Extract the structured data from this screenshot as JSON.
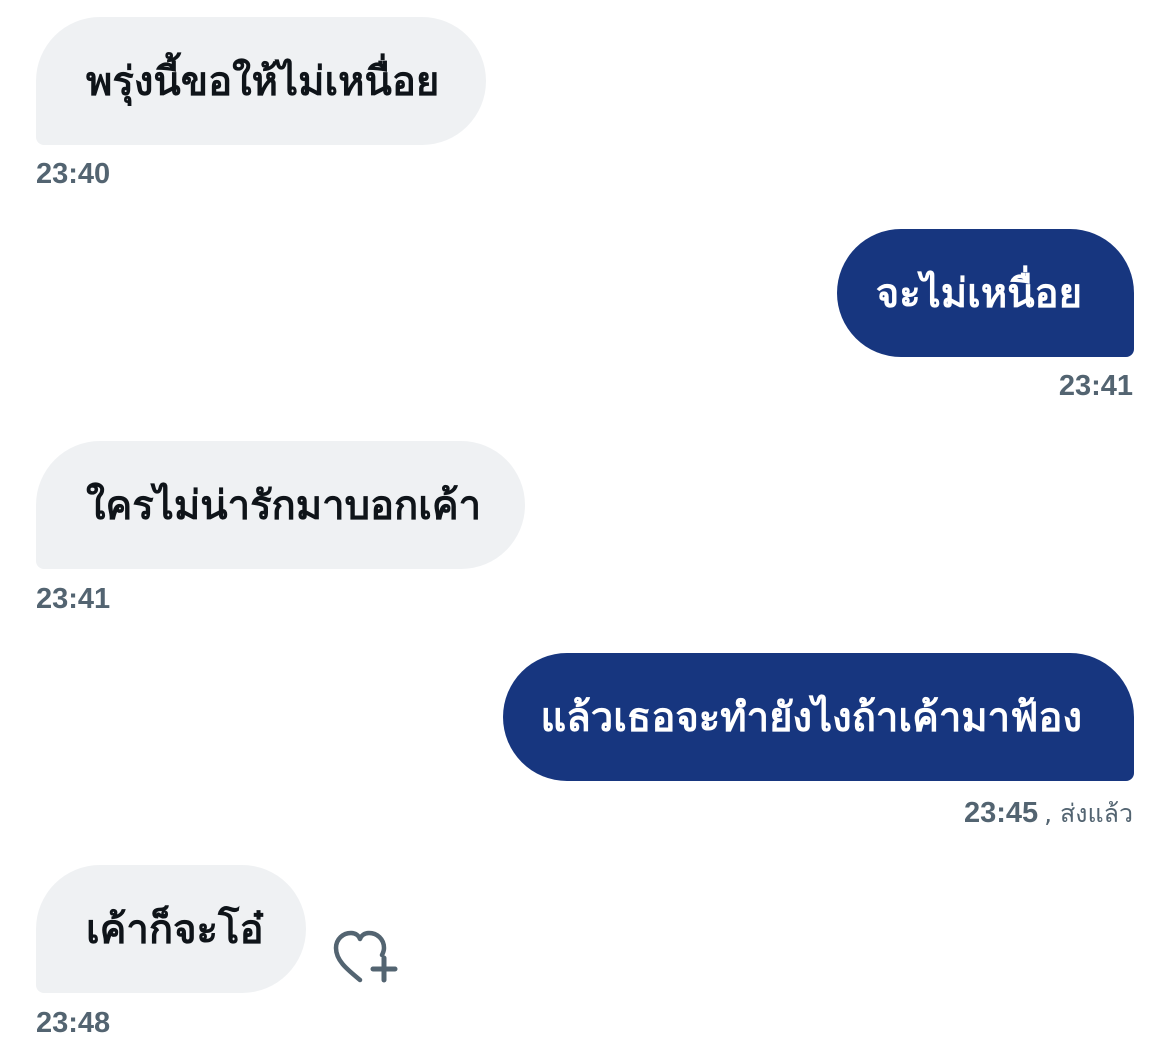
{
  "conversation": {
    "messages": [
      {
        "direction": "incoming",
        "text": "พรุ่งนี้ขอให้ไม่เหนื่อย",
        "time": "23:40"
      },
      {
        "direction": "outgoing",
        "text": "จะไม่เหนื่อย",
        "time": "23:41"
      },
      {
        "direction": "incoming",
        "text": "ใครไม่น่ารักมาบอกเค้า",
        "time": "23:41"
      },
      {
        "direction": "outgoing",
        "text": "แล้วเธอจะทำยังไงถ้าเค้ามาฟ้อง",
        "time": "23:45",
        "status": ", ส่งแล้ว"
      },
      {
        "direction": "incoming",
        "text": "เค้าก็จะโอ๋",
        "time": "23:48"
      }
    ],
    "reaction_button_icon": "heart-plus-icon"
  },
  "colors": {
    "incoming_bubble": "#eff1f3",
    "outgoing_bubble": "#17367f",
    "timestamp": "#536471",
    "reaction_icon": "#536471"
  }
}
